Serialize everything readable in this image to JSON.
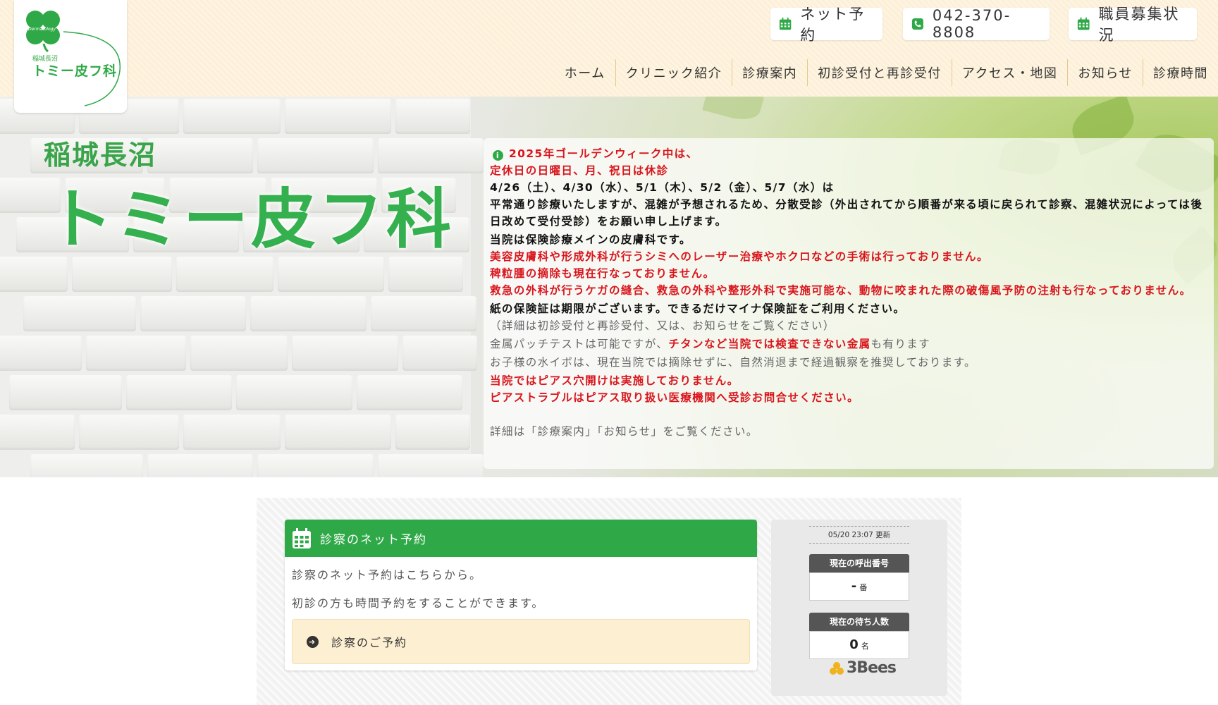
{
  "header": {
    "logo": {
      "small": "稲城長沼",
      "big": "トミー皮フ科",
      "badge": "Dermatology"
    },
    "buttons": {
      "net_reservation": "ネット予約",
      "phone": "042-370-8808",
      "recruit": "職員募集状況"
    },
    "nav": [
      "ホーム",
      "クリニック紹介",
      "診療案内",
      "初診受付と再診受付",
      "アクセス・地図",
      "お知らせ",
      "診療時間"
    ]
  },
  "hero": {
    "logo_small": "稲城長沼",
    "logo_big": "トミー皮フ科",
    "notice": {
      "l1": "2025年ゴールデンウィーク中は、",
      "l2": "定休日の日曜日、月、祝日は休診",
      "l3": "4/26（土）、4/30（水）、5/1（木）、5/2（金）、5/7（水）は",
      "l4": "平常通り診療いたしますが、混雑が予想されるため、分散受診（外出されてから順番が来る頃に戻られて診察、混雑状況によっては後日改めて受付受診）をお願い申し上げます。",
      "l5": "当院は保険診療メインの皮膚科です。",
      "l6": "美容皮膚科や形成外科が行うシミへのレーザー治療やホクロなどの手術は行っておりません。",
      "l7": "稗粒腫の摘除も現在行なっておりません。",
      "l8": "救急の外科が行うケガの縫合、救急の外科や整形外科で実施可能な、動物に咬まれた際の破傷風予防の注射も行なっておりません。",
      "l9": "紙の保険証は期限がございます。できるだけマイナ保険証をご利用ください。",
      "l10": "（詳細は初診受付と再診受付、又は、お知らせをご覧ください）",
      "l11a": "金属パッチテストは可能ですが、",
      "l11b": "チタンなど当院では検査できない金属",
      "l11c": "も有ります",
      "l12": "お子様の水イボは、現在当院では摘除せずに、自然消退まで経過観察を推奨しております。",
      "l13": "当院ではピアス穴開けは実施しておりません。",
      "l14": "ピアストラブルはピアス取り扱い医療機関へ受診お問合せください。",
      "l15": "詳細は「診療案内」「お知らせ」をご覧ください。"
    }
  },
  "reservation_card": {
    "title": "診察のネット予約",
    "line1": "診察のネット予約はこちらから。",
    "line2": "初診の方も時間予約をすることができます。",
    "button": "診察のご予約"
  },
  "queue_widget": {
    "updated": "05/20 23:07 更新",
    "current_label": "現在の呼出番号",
    "current_value": "-",
    "current_unit": "番",
    "waiting_label": "現在の待ち人数",
    "waiting_value": "0",
    "waiting_unit": "名",
    "brand": "3Bees"
  },
  "colors": {
    "brand_green": "#2fa947",
    "alert_red": "#d9151c",
    "header_bg": "#fdf0d8"
  }
}
